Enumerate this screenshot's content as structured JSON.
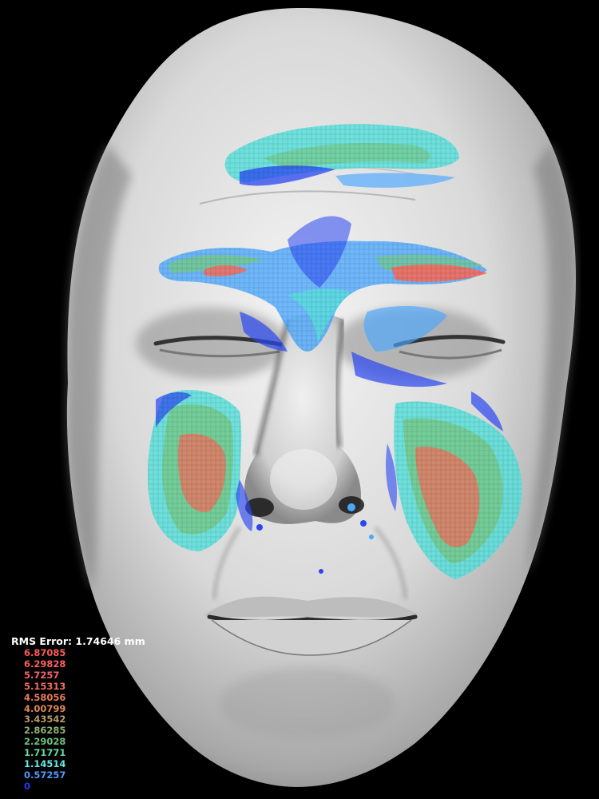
{
  "legend": {
    "title": "RMS Error: 1.74646 mm",
    "items": [
      {
        "value": "6.87085",
        "color": "#ff5a5a"
      },
      {
        "value": "6.29828",
        "color": "#ff5e62"
      },
      {
        "value": "5.7257",
        "color": "#f8636b"
      },
      {
        "value": "5.15313",
        "color": "#f36b60"
      },
      {
        "value": "4.58056",
        "color": "#e97a5a"
      },
      {
        "value": "4.00799",
        "color": "#e0875a"
      },
      {
        "value": "3.43542",
        "color": "#b99a66"
      },
      {
        "value": "2.86285",
        "color": "#8fb073"
      },
      {
        "value": "2.29028",
        "color": "#6fc27c"
      },
      {
        "value": "1.71771",
        "color": "#66dca2"
      },
      {
        "value": "1.14514",
        "color": "#6ae6e6"
      },
      {
        "value": "0.57257",
        "color": "#4f9bff"
      },
      {
        "value": "0",
        "color": "#2538ff"
      }
    ]
  },
  "heatmap_colors": {
    "low": "#2a46f0",
    "low_mid": "#4aa8ff",
    "mid": "#59e0dc",
    "mid_high": "#74c98c",
    "high": "#f46c5c"
  }
}
